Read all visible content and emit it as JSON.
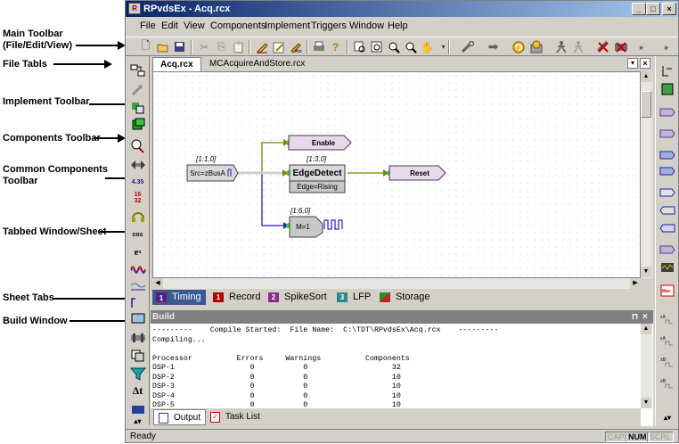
{
  "annotations": {
    "main_toolbar": "Main Toolbar\n(File/Edit/View)",
    "file_tabs": "File Tabls",
    "implement_toolbar": "Implement Toolbar",
    "components_toolbar": "Components Toolbar",
    "common_components_toolbar": "Common Components\nToolbar",
    "tabbed_window": "Tabbed Window/Sheet",
    "sheet_tabs": "Sheet Tabs",
    "build_window": "Build Window"
  },
  "window": {
    "title": "RPvdsEx - Acq.rcx",
    "minimize": "_",
    "maximize": "□",
    "close": "×"
  },
  "menu": {
    "file": "File",
    "edit": "Edit",
    "view": "View",
    "components": "Components",
    "implement": "Implement",
    "triggers": "Triggers",
    "window": "Window",
    "help": "Help"
  },
  "file_tabs": {
    "tab1": "Acq.rcx",
    "tab2": "MCAcquireAndStore.rcx"
  },
  "circuit": {
    "src_index": "[1:1,0]",
    "src_label": "Src=zBusA",
    "enable_label": "Enable",
    "edge_index": "[1:3,0]",
    "edge_label": "EdgeDetect",
    "edge_param": "Edge=Rising",
    "reset_label": "Reset",
    "m_index": "[1:6,0]",
    "m_label": "M=1"
  },
  "sheet_tabs": [
    {
      "num": "1",
      "label": "Timing",
      "color": "#2a2ab0"
    },
    {
      "num": "1",
      "label": "Record",
      "color": "#b00000"
    },
    {
      "num": "2",
      "label": "SpikeSort",
      "color": "#8a2a8a"
    },
    {
      "num": "3",
      "label": "LFP",
      "color": "#2a8a8a"
    },
    {
      "num": "",
      "label": "Storage",
      "color": "#2a8a2a"
    }
  ],
  "build": {
    "title": "Build",
    "log": "---------    Compile Started:  File Name:  C:\\TDT\\RPvdsEx\\Acq.rcx    ---------\nCompiling...\n\nProcessor          Errors     Warnings          Components\nDSP-1                 0           0                   32\nDSP-2                 0           0                   10\nDSP-3                 0           0                   10\nDSP-4                 0           0                   10\nDSP-5                 0           0                   10",
    "tab_output": "Output",
    "tab_tasklist": "Task List"
  },
  "status": {
    "text": "Ready",
    "cap": "CAP",
    "num": "NUM",
    "scrl": "SCRL"
  }
}
